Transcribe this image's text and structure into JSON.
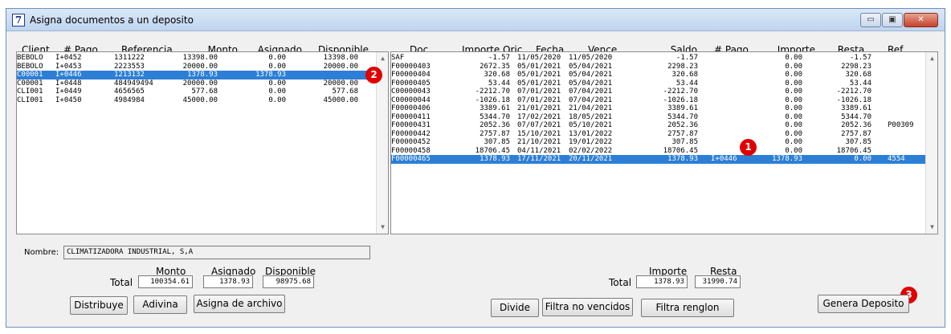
{
  "window": {
    "title": "Asigna documentos a un deposito",
    "icon_glyph": "7"
  },
  "left_headers": [
    "Client",
    "# Pago.",
    "Referencia",
    "Monto",
    "Asignado",
    "Disponible"
  ],
  "left_rows": [
    [
      "BEBOLO",
      "I+0452",
      "1311222",
      "13398.00",
      "0.00",
      "13398.00"
    ],
    [
      "BEBOLO",
      "I+0453",
      "2223553",
      "20000.00",
      "0.00",
      "20000.00"
    ],
    [
      "C00001",
      "I+0446",
      "1213132",
      "1378.93",
      "1378.93",
      ""
    ],
    [
      "C00001",
      "I+0448",
      "484949494",
      "20000.00",
      "0.00",
      "20000.00"
    ],
    [
      "CLI001",
      "I+0449",
      "4656565",
      "577.68",
      "0.00",
      "577.68"
    ],
    [
      "CLI001",
      "I+0450",
      "4984984",
      "45000.00",
      "0.00",
      "45000.00"
    ]
  ],
  "left_selected_index": 2,
  "right_headers": [
    "Doc.",
    "Importe Oriç",
    "Fecha",
    "Vence",
    "Saldo",
    "# Pago",
    "Importe",
    "Resta.",
    "Ref."
  ],
  "right_rows": [
    [
      "SAF",
      "-1.57",
      "11/05/2020",
      "11/05/2020",
      "-1.57",
      "",
      "0.00",
      "-1.57",
      ""
    ],
    [
      "F00000403",
      "2672.35",
      "05/01/2021",
      "05/04/2021",
      "2298.23",
      "",
      "0.00",
      "2298.23",
      ""
    ],
    [
      "F00000404",
      "320.68",
      "05/01/2021",
      "05/04/2021",
      "320.68",
      "",
      "0.00",
      "320.68",
      ""
    ],
    [
      "F00000405",
      "53.44",
      "05/01/2021",
      "05/04/2021",
      "53.44",
      "",
      "0.00",
      "53.44",
      ""
    ],
    [
      "C00000043",
      "-2212.70",
      "07/01/2021",
      "07/04/2021",
      "-2212.70",
      "",
      "0.00",
      "-2212.70",
      ""
    ],
    [
      "C00000044",
      "-1026.18",
      "07/01/2021",
      "07/04/2021",
      "-1026.18",
      "",
      "0.00",
      "-1026.18",
      ""
    ],
    [
      "F00000406",
      "3389.61",
      "21/01/2021",
      "21/04/2021",
      "3389.61",
      "",
      "0.00",
      "3389.61",
      ""
    ],
    [
      "F00000411",
      "5344.70",
      "17/02/2021",
      "18/05/2021",
      "5344.70",
      "",
      "0.00",
      "5344.70",
      ""
    ],
    [
      "F00000431",
      "2052.36",
      "07/07/2021",
      "05/10/2021",
      "2052.36",
      "",
      "0.00",
      "2052.36",
      "P00309"
    ],
    [
      "F00000442",
      "2757.87",
      "15/10/2021",
      "13/01/2022",
      "2757.87",
      "",
      "0.00",
      "2757.87",
      ""
    ],
    [
      "F00000452",
      "307.85",
      "21/10/2021",
      "19/01/2022",
      "307.85",
      "",
      "0.00",
      "307.85",
      ""
    ],
    [
      "F00000458",
      "18706.45",
      "04/11/2021",
      "02/02/2022",
      "18706.45",
      "",
      "0.00",
      "18706.45",
      ""
    ],
    [
      "F00000465",
      "1378.93",
      "17/11/2021",
      "20/11/2021",
      "1378.93",
      "I+0446",
      "1378.93",
      "0.00",
      "4554"
    ]
  ],
  "right_selected_index": 12,
  "badges": {
    "b1": "1",
    "b2": "2",
    "b3": "3"
  },
  "nombre": {
    "label": "Nombre:",
    "value": "CLIMATIZADORA INDUSTRIAL, S,A"
  },
  "left_totals": {
    "label": "Total",
    "monto_label": "Monto",
    "asignado_label": "Asignado",
    "disponible_label": "Disponible",
    "monto": "100354.61",
    "asignado": "1378.93",
    "disponible": "98975.68"
  },
  "right_totals": {
    "label": "Total",
    "importe_label": "Importe",
    "resta_label": "Resta",
    "importe": "1378.93",
    "resta": "31990.74"
  },
  "buttons": {
    "distribuye": "Distribuye",
    "adivina": "Adivina",
    "asigna_archivo": "Asigna de archivo",
    "divide": "Divide",
    "filtra_no_vencidos": "Filtra no vencidos",
    "filtra_renglon": "Filtra renglon",
    "genera_deposito": "Genera Deposito"
  },
  "icons": {
    "scroll_up": "▲",
    "scroll_down": "▼",
    "minimize": "▭",
    "maximize": "▣",
    "close": "✕"
  }
}
